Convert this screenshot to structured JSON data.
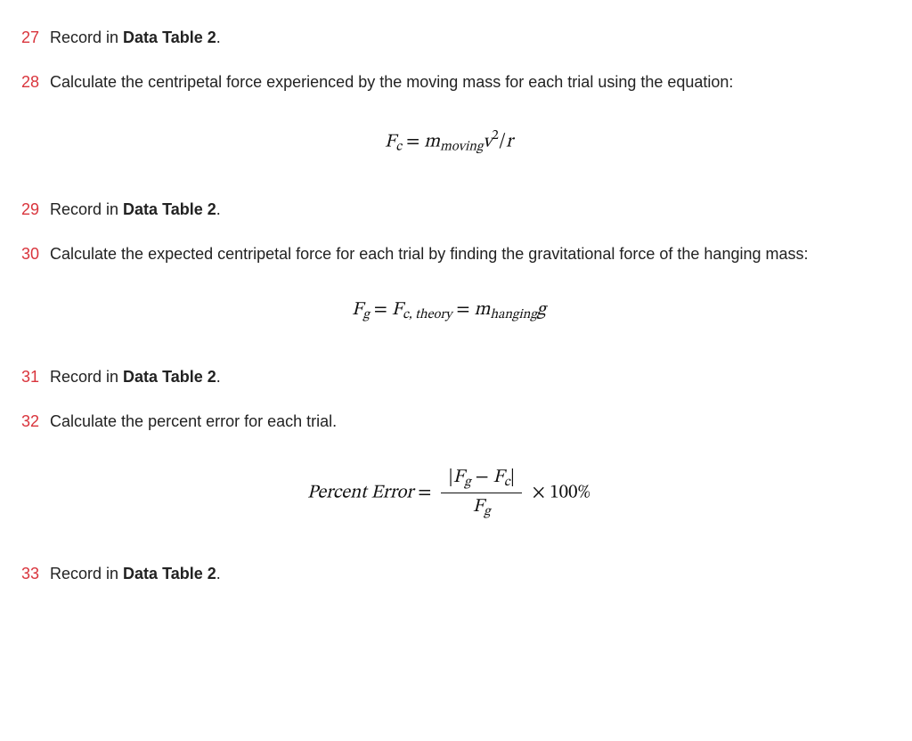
{
  "steps": {
    "s27": {
      "num": "27",
      "text_pre": "Record in ",
      "bold": "Data Table 2",
      "text_post": "."
    },
    "s28": {
      "num": "28",
      "text": "Calculate the centripetal force experienced by the moving mass for each trial using the equation:"
    },
    "s29": {
      "num": "29",
      "text_pre": "Record in ",
      "bold": "Data Table 2",
      "text_post": "."
    },
    "s30": {
      "num": "30",
      "text": "Calculate the expected centripetal force for each trial by finding the gravitational force of the hanging mass:"
    },
    "s31": {
      "num": "31",
      "text_pre": "Record in ",
      "bold": "Data Table 2",
      "text_post": "."
    },
    "s32": {
      "num": "32",
      "text": "Calculate the percent error for each trial."
    },
    "s33": {
      "num": "33",
      "text_pre": "Record in ",
      "bold": "Data Table 2",
      "text_post": "."
    }
  },
  "eq1": {
    "F": "F",
    "c": "c",
    "eq": " = ",
    "m": "m",
    "moving": "moving",
    "v": "v",
    "two": "2",
    "slash": "/",
    "r": "r"
  },
  "eq2": {
    "F": "F",
    "g": "g",
    "eq1": " = ",
    "F2": "F",
    "ctheory": "c, theory",
    "eq2": " = ",
    "m": "m",
    "hanging": "hanging",
    "gg": "g"
  },
  "eq3": {
    "label": "Percent Error",
    "eq": " = ",
    "abs1": "|",
    "F": "F",
    "g": "g",
    "minus": " − ",
    "F2": "F",
    "c": "c",
    "abs2": "|",
    "denF": "F",
    "deng": "g",
    "times": " × ",
    "hundred": "100%"
  }
}
